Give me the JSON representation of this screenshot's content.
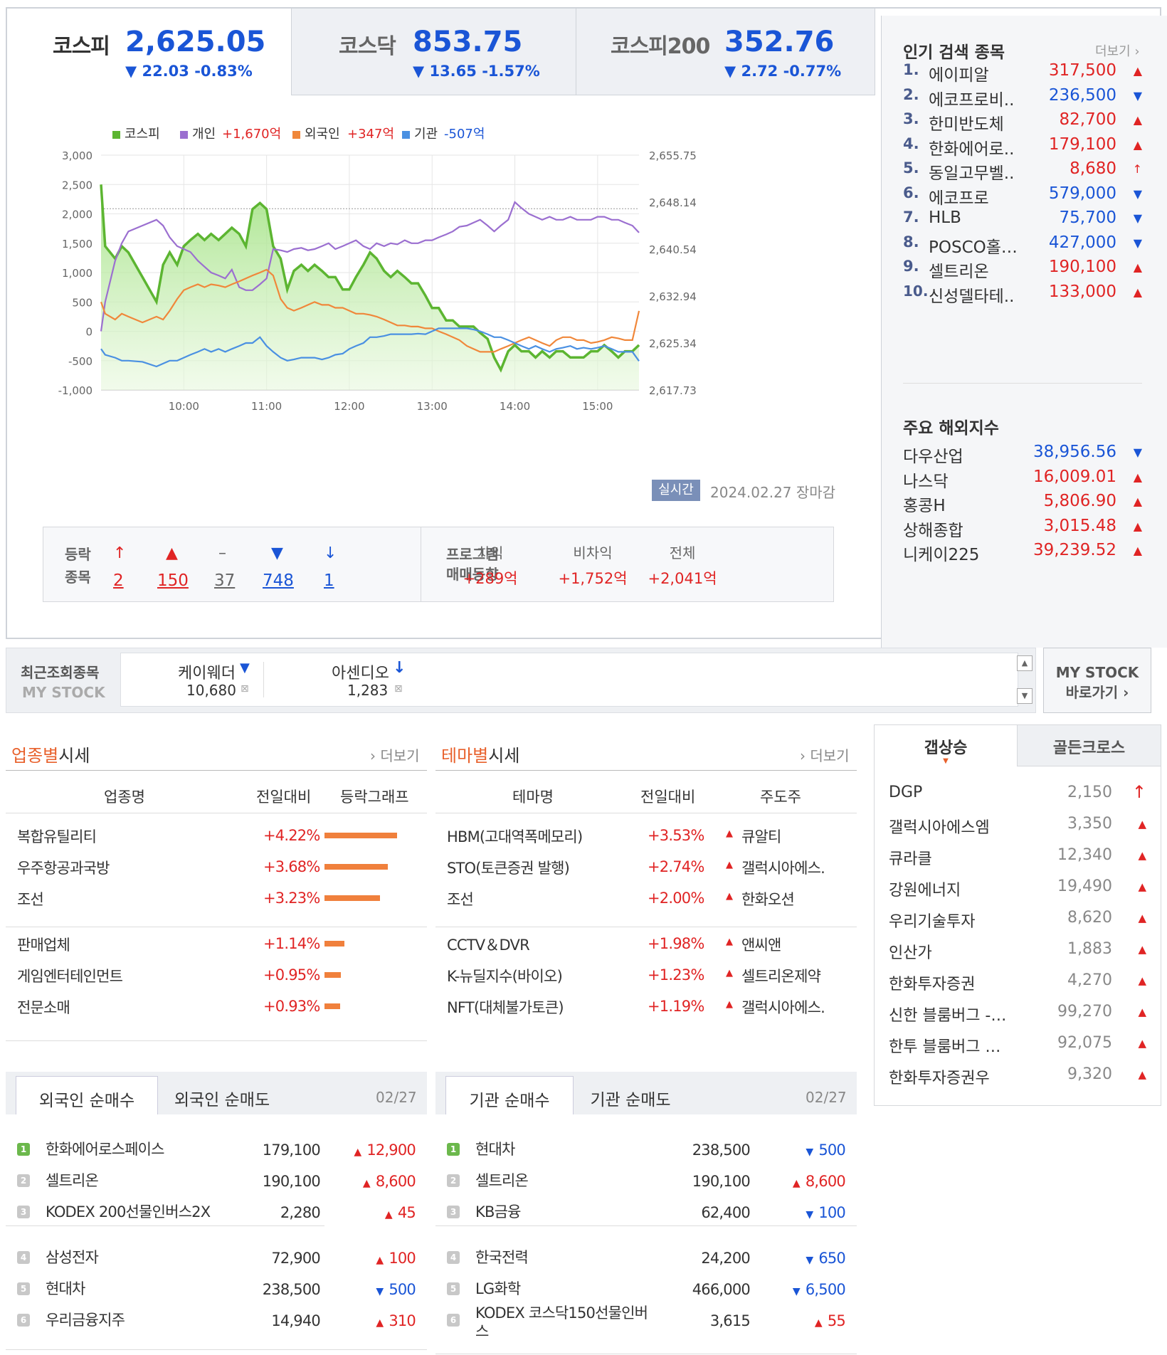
{
  "indices": [
    {
      "name": "코스피",
      "value": "2,625.05",
      "change": "▼ 22.03 -0.83%"
    },
    {
      "name": "코스닥",
      "value": "853.75",
      "change": "▼ 13.65 -1.57%"
    },
    {
      "name": "코스피200",
      "value": "352.76",
      "change": "▼ 2.72 -0.77%"
    }
  ],
  "chart_data": {
    "type": "line",
    "legend": [
      {
        "name": "코스피",
        "value": "",
        "color": "#5cb531"
      },
      {
        "name": "개인",
        "value": "+1,670억",
        "color": "#9b6fd0"
      },
      {
        "name": "외국인",
        "value": "+347억",
        "color": "#f0873a"
      },
      {
        "name": "기관",
        "value": "-507억",
        "color": "#4a90e2"
      }
    ],
    "y_left_ticks": [
      "3,000",
      "2,500",
      "2,000",
      "1,500",
      "1,000",
      "500",
      "0",
      "-500",
      "-1,000"
    ],
    "y_right_ticks": [
      "2,655.75",
      "2,648.14",
      "2,640.54",
      "2,632.94",
      "2,625.34",
      "2,617.73"
    ],
    "x_ticks": [
      "10:00",
      "11:00",
      "12:00",
      "13:00",
      "14:00",
      "15:00"
    ],
    "ylim_left": [
      -1000,
      3000
    ],
    "ylim_right": [
      2617.73,
      2655.75
    ],
    "reference_line": 2647.08,
    "x_hours": [
      9.0,
      9.05,
      9.17,
      9.25,
      9.33,
      9.5,
      9.67,
      9.75,
      9.83,
      9.92,
      10.0,
      10.08,
      10.17,
      10.25,
      10.33,
      10.42,
      10.5,
      10.58,
      10.67,
      10.75,
      10.83,
      10.92,
      11.0,
      11.08,
      11.17,
      11.25,
      11.33,
      11.42,
      11.5,
      11.58,
      11.67,
      11.75,
      11.83,
      11.92,
      12.0,
      12.08,
      12.17,
      12.25,
      12.33,
      12.42,
      12.5,
      12.58,
      12.67,
      12.75,
      12.83,
      12.92,
      13.0,
      13.08,
      13.17,
      13.25,
      13.33,
      13.42,
      13.5,
      13.58,
      13.67,
      13.75,
      13.83,
      13.92,
      14.0,
      14.08,
      14.17,
      14.25,
      14.33,
      14.42,
      14.5,
      14.58,
      14.67,
      14.75,
      14.83,
      14.92,
      15.0,
      15.08,
      15.17,
      15.25,
      15.33,
      15.42,
      15.5
    ],
    "series": [
      {
        "name": "코스피",
        "axis": "right",
        "values": [
          2651,
          2641,
          2639,
          2641,
          2640,
          2636,
          2632,
          2638,
          2640,
          2638,
          2641,
          2642,
          2643,
          2642,
          2643,
          2642,
          2643,
          2644,
          2643,
          2641,
          2647,
          2648,
          2647,
          2641,
          2639,
          2634,
          2637,
          2638,
          2637,
          2638,
          2637,
          2636,
          2636,
          2634,
          2634,
          2636,
          2638,
          2640,
          2639,
          2637,
          2636,
          2637,
          2636,
          2635,
          2635,
          2633,
          2631,
          2631,
          2629,
          2629,
          2628,
          2628,
          2628,
          2627,
          2626,
          2623,
          2621,
          2624,
          2625,
          2624,
          2624,
          2623,
          2624,
          2623,
          2624,
          2624,
          2623,
          2623,
          2623,
          2624,
          2624,
          2625,
          2624,
          2623,
          2624,
          2624,
          2625
        ]
      },
      {
        "name": "개인",
        "axis": "left",
        "values": [
          0,
          500,
          1200,
          1500,
          1700,
          1800,
          1900,
          1800,
          1600,
          1450,
          1400,
          1350,
          1200,
          1100,
          1000,
          950,
          900,
          1050,
          750,
          700,
          700,
          800,
          900,
          1400,
          1380,
          1350,
          1400,
          1420,
          1380,
          1400,
          1450,
          1500,
          1400,
          1450,
          1500,
          1550,
          1450,
          1400,
          1500,
          1450,
          1500,
          1480,
          1550,
          1500,
          1500,
          1550,
          1550,
          1600,
          1650,
          1700,
          1780,
          1800,
          1850,
          1900,
          1800,
          1700,
          1800,
          1900,
          2200,
          2100,
          2000,
          1950,
          1900,
          1950,
          1900,
          1900,
          1950,
          1900,
          1900,
          1900,
          1950,
          1950,
          1900,
          1900,
          1850,
          1800,
          1680
        ]
      },
      {
        "name": "외국인",
        "axis": "left",
        "values": [
          500,
          300,
          200,
          300,
          250,
          150,
          250,
          200,
          350,
          550,
          700,
          750,
          800,
          750,
          800,
          780,
          750,
          800,
          850,
          900,
          950,
          1000,
          1050,
          950,
          550,
          400,
          350,
          400,
          450,
          500,
          450,
          450,
          400,
          400,
          350,
          300,
          300,
          280,
          250,
          200,
          150,
          100,
          100,
          80,
          80,
          50,
          50,
          0,
          -50,
          -100,
          -150,
          -250,
          -300,
          -350,
          -350,
          -350,
          -300,
          -250,
          -200,
          -150,
          -100,
          -150,
          -200,
          -250,
          -150,
          -100,
          -100,
          -150,
          -150,
          -200,
          -180,
          -150,
          -100,
          -120,
          -150,
          -150,
          347
        ]
      },
      {
        "name": "기관",
        "axis": "left",
        "values": [
          -300,
          -400,
          -450,
          -500,
          -500,
          -520,
          -600,
          -550,
          -500,
          -500,
          -450,
          -400,
          -350,
          -300,
          -350,
          -300,
          -350,
          -300,
          -250,
          -200,
          -200,
          -100,
          -250,
          -350,
          -450,
          -500,
          -480,
          -450,
          -450,
          -450,
          -480,
          -450,
          -400,
          -380,
          -300,
          -250,
          -200,
          -100,
          -100,
          -80,
          -50,
          -50,
          -50,
          -50,
          -40,
          -50,
          0,
          50,
          50,
          50,
          50,
          50,
          30,
          0,
          -50,
          -100,
          -100,
          -150,
          -200,
          -250,
          -300,
          -250,
          -300,
          -350,
          -300,
          -280,
          -250,
          -300,
          -280,
          -300,
          -280,
          -250,
          -300,
          -350,
          -350,
          -350,
          -507
        ]
      }
    ]
  },
  "realtime_label": "실시간",
  "date_label": "2024.02.27 장마감",
  "updown": {
    "label1": "등락",
    "label2": "종목",
    "items": [
      {
        "sym": "↑",
        "n": "2",
        "color": "red"
      },
      {
        "sym": "▲",
        "n": "150",
        "color": "red"
      },
      {
        "sym": "–",
        "n": "37",
        "color": "gray"
      },
      {
        "sym": "▼",
        "n": "748",
        "color": "blue"
      },
      {
        "sym": "↓",
        "n": "1",
        "color": "blue"
      }
    ],
    "program1": "프로그램",
    "program2": "매매동향",
    "prog": [
      {
        "h": "차익",
        "v": "+289억"
      },
      {
        "h": "비차익",
        "v": "+1,752억"
      },
      {
        "h": "전체",
        "v": "+2,041억"
      }
    ]
  },
  "popular": {
    "title": "인기 검색 종목",
    "more": "더보기",
    "items": [
      {
        "rank": "1.",
        "name": "에이피알",
        "price": "317,500",
        "dir": "up"
      },
      {
        "rank": "2.",
        "name": "에코프로비..",
        "price": "236,500",
        "dir": "down"
      },
      {
        "rank": "3.",
        "name": "한미반도체",
        "price": "82,700",
        "dir": "up"
      },
      {
        "rank": "4.",
        "name": "한화에어로..",
        "price": "179,100",
        "dir": "up"
      },
      {
        "rank": "5.",
        "name": "동일고무벨..",
        "price": "8,680",
        "dir": "upper"
      },
      {
        "rank": "6.",
        "name": "에코프로",
        "price": "579,000",
        "dir": "down"
      },
      {
        "rank": "7.",
        "name": "HLB",
        "price": "75,700",
        "dir": "down"
      },
      {
        "rank": "8.",
        "name": "POSCO홀…",
        "price": "427,000",
        "dir": "down"
      },
      {
        "rank": "9.",
        "name": "셀트리온",
        "price": "190,100",
        "dir": "up"
      },
      {
        "rank": "10.",
        "name": "신성델타테..",
        "price": "133,000",
        "dir": "up"
      }
    ]
  },
  "world": {
    "title": "주요 해외지수",
    "items": [
      {
        "name": "다우산업",
        "value": "38,956.56",
        "dir": "down"
      },
      {
        "name": "나스닥",
        "value": "16,009.01",
        "dir": "up"
      },
      {
        "name": "홍콩H",
        "value": "5,806.90",
        "dir": "up"
      },
      {
        "name": "상해종합",
        "value": "3,015.48",
        "dir": "up"
      },
      {
        "name": "니케이225",
        "value": "39,239.52",
        "dir": "up"
      }
    ]
  },
  "recent": {
    "label1": "최근조회종목",
    "label2": "MY STOCK",
    "items": [
      {
        "name": "케이웨더",
        "price": "10,680",
        "dir": "down"
      },
      {
        "name": "아센디오",
        "price": "1,283",
        "dir": "lower"
      }
    ],
    "btn1": "MY STOCK",
    "btn2": "바로가기"
  },
  "industry": {
    "title_acc": "업종별",
    "title_rest": "시세",
    "more": "더보기",
    "headers": [
      "업종명",
      "전일대비",
      "등락그래프"
    ],
    "rows": [
      {
        "name": "복합유틸리티",
        "chg": "+4.22%",
        "pct": 4.22
      },
      {
        "name": "우주항공과국방",
        "chg": "+3.68%",
        "pct": 3.68
      },
      {
        "name": "조선",
        "chg": "+3.23%",
        "pct": 3.23
      },
      {
        "name": "판매업체",
        "chg": "+1.14%",
        "pct": 1.14
      },
      {
        "name": "게임엔터테인먼트",
        "chg": "+0.95%",
        "pct": 0.95
      },
      {
        "name": "전문소매",
        "chg": "+0.93%",
        "pct": 0.93
      }
    ]
  },
  "theme": {
    "title_acc": "테마별",
    "title_rest": "시세",
    "more": "더보기",
    "headers": [
      "테마명",
      "전일대비",
      "주도주"
    ],
    "rows": [
      {
        "name": "HBM(고대역폭메모리)",
        "chg": "+3.53%",
        "lead": "큐알티"
      },
      {
        "name": "STO(토큰증권 발행)",
        "chg": "+2.74%",
        "lead": "갤럭시아에스."
      },
      {
        "name": "조선",
        "chg": "+2.00%",
        "lead": "한화오션"
      },
      {
        "name": "CCTV＆DVR",
        "chg": "+1.98%",
        "lead": "앤씨앤"
      },
      {
        "name": "K-뉴딜지수(바이오)",
        "chg": "+1.23%",
        "lead": "셀트리온제약"
      },
      {
        "name": "NFT(대체불가토큰)",
        "chg": "+1.19%",
        "lead": "갤럭시아에스."
      }
    ]
  },
  "gap": {
    "tab1": "갭상승",
    "tab2": "골든크로스",
    "items": [
      {
        "name": "DGP",
        "price": "2,150",
        "dir": "upper"
      },
      {
        "name": "갤럭시아에스엠",
        "price": "3,350",
        "dir": "up"
      },
      {
        "name": "큐라클",
        "price": "12,340",
        "dir": "up"
      },
      {
        "name": "강원에너지",
        "price": "19,490",
        "dir": "up"
      },
      {
        "name": "우리기술투자",
        "price": "8,620",
        "dir": "up"
      },
      {
        "name": "인산가",
        "price": "1,883",
        "dir": "up"
      },
      {
        "name": "한화투자증권",
        "price": "4,270",
        "dir": "up"
      },
      {
        "name": "신한 블룸버그 -…",
        "price": "99,270",
        "dir": "up"
      },
      {
        "name": "한투 블룸버그 …",
        "price": "92,075",
        "dir": "up"
      },
      {
        "name": "한화투자증권우",
        "price": "9,320",
        "dir": "up"
      }
    ]
  },
  "foreign": {
    "tab1": "외국인 순매수",
    "tab2": "외국인 순매도",
    "date": "02/27",
    "rows": [
      {
        "rank": "1",
        "name": "한화에어로스페이스",
        "price": "179,100",
        "chg": "12,900",
        "dir": "up"
      },
      {
        "rank": "2",
        "name": "셀트리온",
        "price": "190,100",
        "chg": "8,600",
        "dir": "up"
      },
      {
        "rank": "3",
        "name": "KODEX 200선물인버스2X",
        "price": "2,280",
        "chg": "45",
        "dir": "up"
      },
      {
        "rank": "4",
        "name": "삼성전자",
        "price": "72,900",
        "chg": "100",
        "dir": "up"
      },
      {
        "rank": "5",
        "name": "현대차",
        "price": "238,500",
        "chg": "500",
        "dir": "down"
      },
      {
        "rank": "6",
        "name": "우리금융지주",
        "price": "14,940",
        "chg": "310",
        "dir": "up"
      }
    ]
  },
  "inst": {
    "tab1": "기관 순매수",
    "tab2": "기관 순매도",
    "date": "02/27",
    "rows": [
      {
        "rank": "1",
        "name": "현대차",
        "price": "238,500",
        "chg": "500",
        "dir": "down"
      },
      {
        "rank": "2",
        "name": "셀트리온",
        "price": "190,100",
        "chg": "8,600",
        "dir": "up"
      },
      {
        "rank": "3",
        "name": "KB금융",
        "price": "62,400",
        "chg": "100",
        "dir": "down"
      },
      {
        "rank": "4",
        "name": "한국전력",
        "price": "24,200",
        "chg": "650",
        "dir": "down"
      },
      {
        "rank": "5",
        "name": "LG화학",
        "price": "466,000",
        "chg": "6,500",
        "dir": "down"
      },
      {
        "rank": "6",
        "name": "KODEX 코스닥150선물인버스",
        "price": "3,615",
        "chg": "55",
        "dir": "up"
      }
    ]
  },
  "colors": {
    "up": "#e02424",
    "down": "#1a55d6",
    "accent": "#e8612c",
    "kospi": "#5cb531"
  }
}
